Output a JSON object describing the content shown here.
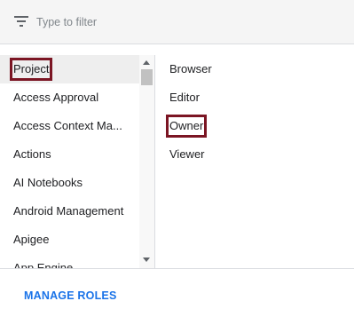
{
  "filter": {
    "placeholder": "Type to filter",
    "icon": "filter-list-icon"
  },
  "services": [
    {
      "label": "Project",
      "selected": true
    },
    {
      "label": "Access Approval"
    },
    {
      "label": "Access Context Ma..."
    },
    {
      "label": "Actions"
    },
    {
      "label": "AI Notebooks"
    },
    {
      "label": "Android Management"
    },
    {
      "label": "Apigee"
    },
    {
      "label": "App Engine"
    }
  ],
  "roles": [
    {
      "label": "Browser"
    },
    {
      "label": "Editor"
    },
    {
      "label": "Owner",
      "highlighted": true
    },
    {
      "label": "Viewer"
    }
  ],
  "footer": {
    "manage_roles_label": "MANAGE ROLES"
  },
  "colors": {
    "accent": "#1a73e8",
    "highlight_outline": "#7b1523"
  }
}
